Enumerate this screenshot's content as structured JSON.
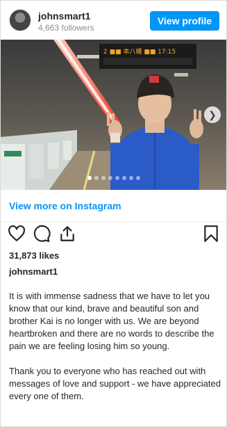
{
  "header": {
    "username": "johnsmart1",
    "followers": "4,663 followers",
    "view_profile_label": "View profile"
  },
  "photo": {
    "sign_text": "2 ■■ 本八幡 ■■ 17:15",
    "carousel_total": 8,
    "carousel_active": 1,
    "next_icon": "chevron-right-icon"
  },
  "view_more_label": "View more on Instagram",
  "actions": {
    "like_icon": "heart-icon",
    "comment_icon": "comment-icon",
    "share_icon": "share-icon",
    "save_icon": "bookmark-icon"
  },
  "likes": "31,873 likes",
  "caption": {
    "username": "johnsmart1",
    "paragraph_1": "It is with immense sadness that we have to let you know that our kind, brave and beautiful son and brother Kai is no longer with us. We are beyond heartbroken and there are no words to describe the pain we are feeling losing him so young.",
    "paragraph_2": "Thank you to everyone who has reached out with messages of love and support - we have appreciated every one of them."
  },
  "colors": {
    "accent": "#0095f6",
    "jacket": "#2a5bc7",
    "light_trail": "#ff5a3c"
  }
}
